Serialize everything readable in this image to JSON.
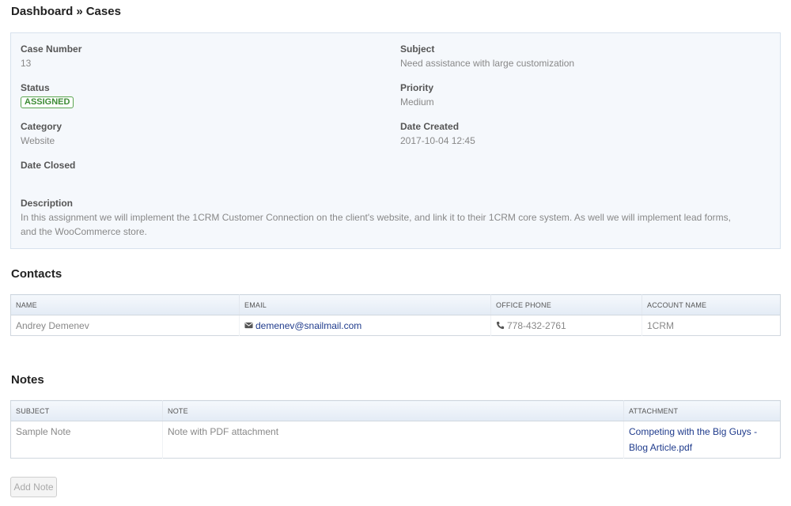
{
  "breadcrumb": {
    "home": "Dashboard",
    "separator": "»",
    "current": "Cases"
  },
  "case": {
    "case_number_label": "Case Number",
    "case_number": "13",
    "subject_label": "Subject",
    "subject": "Need assistance with large customization",
    "status_label": "Status",
    "status": "ASSIGNED",
    "priority_label": "Priority",
    "priority": "Medium",
    "category_label": "Category",
    "category": "Website",
    "date_created_label": "Date Created",
    "date_created": "2017-10-04 12:45",
    "date_closed_label": "Date Closed",
    "date_closed": "",
    "description_label": "Description",
    "description": "In this assignment we will implement the 1CRM Customer Connection on the client's website, and link it to their 1CRM core system. As well we will implement lead forms, and the WooCommerce store."
  },
  "contacts": {
    "title": "Contacts",
    "columns": [
      "NAME",
      "EMAIL",
      "OFFICE PHONE",
      "ACCOUNT NAME"
    ],
    "rows": [
      {
        "name": "Andrey Demenev",
        "email": "demenev@snailmail.com",
        "phone": "778-432-2761",
        "account": "1CRM"
      }
    ]
  },
  "notes": {
    "title": "Notes",
    "columns": [
      "SUBJECT",
      "NOTE",
      "ATTACHMENT"
    ],
    "rows": [
      {
        "subject": "Sample Note",
        "note": "Note with PDF attachment",
        "attachment": "Competing with the Big Guys - Blog Article.pdf"
      }
    ],
    "add_button": "Add Note"
  },
  "icons": {
    "email": "envelope-icon",
    "phone": "phone-icon"
  },
  "colors": {
    "status_green": "#3c8b34",
    "link": "#1f3b8c",
    "panel_bg": "#f5f8fc"
  }
}
